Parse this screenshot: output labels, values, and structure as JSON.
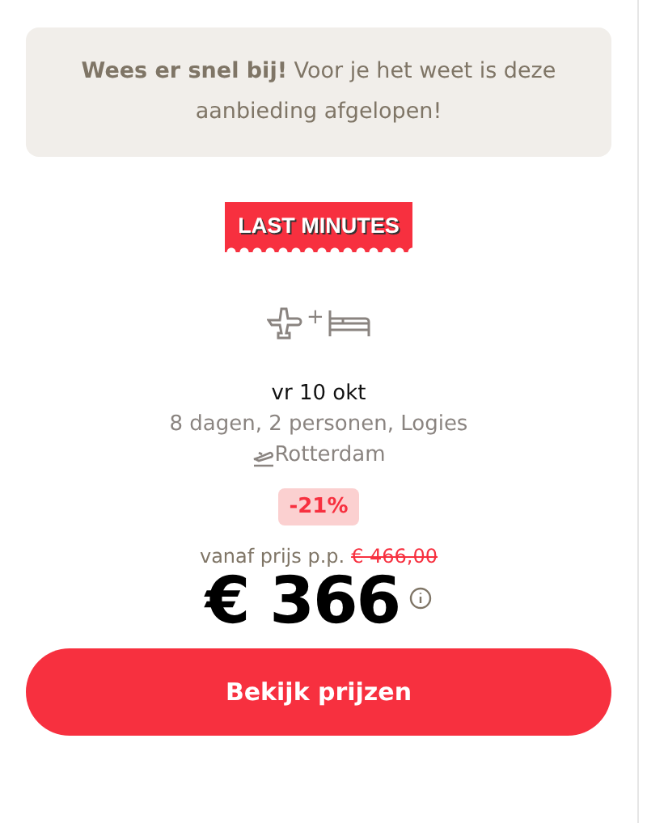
{
  "notice": "**Wees er snel bij!** Voor je het weet is deze aanbieding afgelopen!",
  "badge": "LAST MINUTES",
  "plus": "+",
  "date": "vr 10 okt",
  "details": "8 dagen, 2 personen, Logies",
  "departure": "Rotterdam",
  "discount": "-21%",
  "price_label": "vanaf prijs p.p.",
  "old_price": "€ 466,00",
  "price": "€ 366",
  "button": "Bekijk prijzen"
}
